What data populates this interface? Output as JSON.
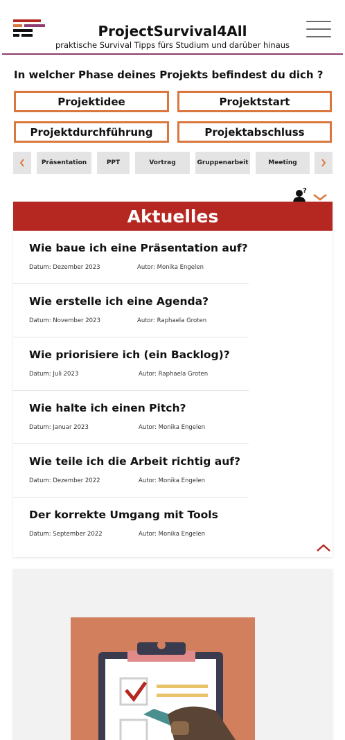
{
  "header": {
    "title": "ProjectSurvival4All",
    "subtitle": "praktische Survival Tipps fürs Studium und darüber hinaus",
    "logo_icon": "brick-wall-logo",
    "menu_icon": "hamburger-menu-icon",
    "accent_color": "#8e3b6e"
  },
  "phases": {
    "question": "In welcher Phase deines Projekts befindest du dich ?",
    "buttons": [
      "Projektidee",
      "Projektstart",
      "Projektdurchführung",
      "Projektabschluss"
    ],
    "border_color": "#d9773e"
  },
  "tags": {
    "items": [
      "Präsentation",
      "PPT",
      "Vortrag",
      "Gruppenarbeit",
      "Meeting"
    ],
    "prev_icon": "chevron-left-icon",
    "next_icon": "chevron-right-icon"
  },
  "filter": {
    "icon": "user-question-icon",
    "toggle_icon": "chevron-down-icon"
  },
  "news": {
    "heading": "Aktuelles",
    "heading_color": "#b52822",
    "collapse_icon": "chevron-up-icon",
    "articles": [
      {
        "title": "Wie baue ich eine Präsentation auf?",
        "date": "Datum: Dezember 2023",
        "author": "Autor: Monika Engelen"
      },
      {
        "title": "Wie erstelle ich eine Agenda?",
        "date": "Datum: November 2023",
        "author": "Autor: Raphaela Groten"
      },
      {
        "title": "Wie priorisiere ich (ein Backlog)?",
        "date": "Datum: Juli 2023",
        "author": "Autor: Raphaela Groten"
      },
      {
        "title": "Wie halte ich einen Pitch?",
        "date": "Datum: Januar 2023",
        "author": "Autor: Monika Engelen"
      },
      {
        "title": "Wie teile ich die Arbeit richtig auf?",
        "date": "Datum: Dezember 2022",
        "author": "Autor: Monika Engelen"
      },
      {
        "title": "Der korrekte Umgang mit Tools",
        "date": "Datum: September 2022",
        "author": "Autor: Monika Engelen"
      }
    ]
  },
  "card": {
    "illustration": "clipboard-checklist-illustration"
  }
}
